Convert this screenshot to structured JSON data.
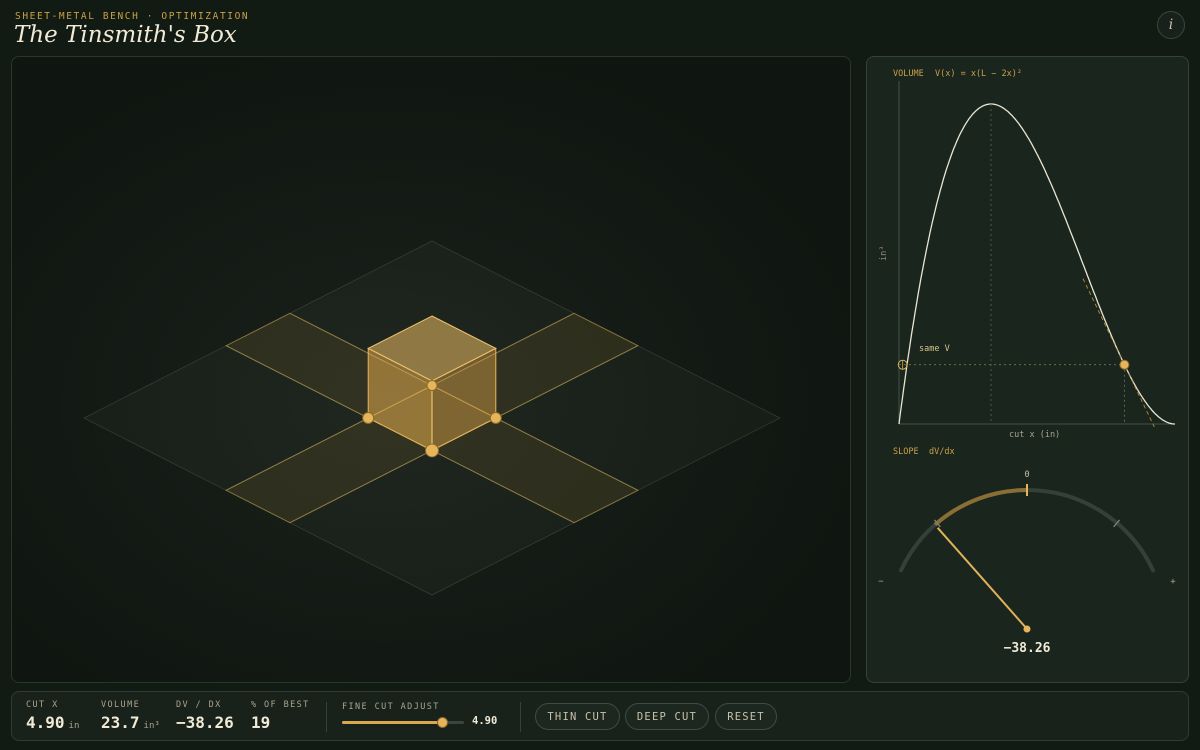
{
  "header": {
    "kicker": "SHEET-METAL BENCH · OPTIMIZATION",
    "title": "The Tinsmith's Box",
    "info_label": "i"
  },
  "colors": {
    "accent": "#e6b45a",
    "background": "#121a14",
    "curve": "#eae6d2"
  },
  "volume_plot": {
    "label": "VOLUME",
    "formula": "V(x) = x(L − 2x)²",
    "ylabel": "in³",
    "xlabel": "cut x  (in)",
    "marker_label": "same V"
  },
  "chart_data": {
    "type": "line",
    "title": "VOLUME  V(x) = x(L − 2x)²",
    "xlabel": "cut x  (in)",
    "ylabel": "in³",
    "sheet_side_L": 12,
    "xlim": [
      0,
      6
    ],
    "current_x": 4.9,
    "current_v": 23.7,
    "same_v_x": 0.08,
    "grid": true,
    "series": [
      {
        "x": [
          0,
          0.5,
          1,
          1.5,
          2,
          2.5,
          3,
          3.5,
          4,
          4.5,
          5,
          5.5,
          6
        ],
        "values": [
          0,
          60.5,
          100,
          121.5,
          128,
          122.5,
          108,
          87.5,
          64,
          40.5,
          20,
          5.5,
          0
        ]
      }
    ]
  },
  "slope_gauge": {
    "label": "SLOPE",
    "sublabel": "dV/dx",
    "zero_label": "0",
    "minus_label": "−",
    "plus_label": "+",
    "value": -38.26,
    "value_text": "−38.26",
    "range": [
      -60,
      60
    ]
  },
  "stats": {
    "cut_x": {
      "label": "CUT X",
      "value": "4.90",
      "unit": "in"
    },
    "volume": {
      "label": "VOLUME",
      "value": "23.7",
      "unit": "in³"
    },
    "dvdx": {
      "label": "DV / DX",
      "value": "−38.26"
    },
    "pct_best": {
      "label": "% OF BEST",
      "value": "19"
    }
  },
  "fine_adjust": {
    "label": "FINE CUT ADJUST",
    "value": 4.9,
    "value_text": "4.90",
    "min": 0,
    "max": 6
  },
  "buttons": {
    "thin_cut": "THIN CUT",
    "deep_cut": "DEEP CUT",
    "reset": "RESET"
  }
}
